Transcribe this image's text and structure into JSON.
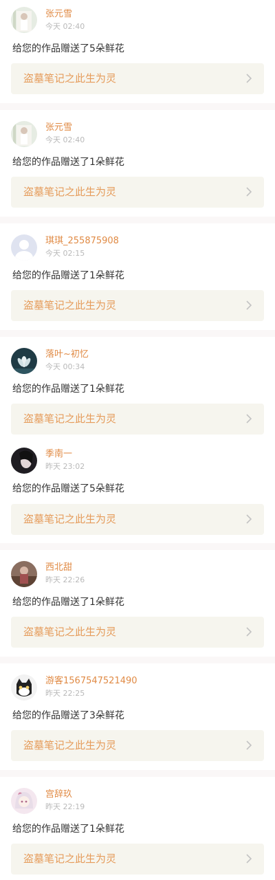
{
  "notifications": [
    {
      "user": "张元雪",
      "time": "今天 02:40",
      "message": "给您的作品赠送了5朵鲜花",
      "work": "盗墓笔记之此生为灵",
      "avatar": "avatar-photo-girl-icon"
    },
    {
      "user": "张元雪",
      "time": "今天 02:40",
      "message": "给您的作品赠送了1朵鲜花",
      "work": "盗墓笔记之此生为灵",
      "avatar": "avatar-photo-girl-icon"
    },
    {
      "user": "琪琪_255875908",
      "time": "今天 02:15",
      "message": "给您的作品赠送了1朵鲜花",
      "work": "盗墓笔记之此生为灵",
      "avatar": "default-avatar-icon"
    },
    {
      "user": "落叶~初忆",
      "time": "今天 00:34",
      "message": "给您的作品赠送了1朵鲜花",
      "work": "盗墓笔记之此生为灵",
      "avatar": "lotus-avatar-icon"
    },
    {
      "user": "季南一",
      "time": "昨天 23:02",
      "message": "给您的作品赠送了5朵鲜花",
      "work": "盗墓笔记之此生为灵",
      "avatar": "dark-portrait-avatar-icon"
    },
    {
      "user": "西北甜",
      "time": "昨天 22:26",
      "message": "给您的作品赠送了1朵鲜花",
      "work": "盗墓笔记之此生为灵",
      "avatar": "photo-avatar-icon"
    },
    {
      "user": "游客1567547521490",
      "time": "昨天 22:25",
      "message": "给您的作品赠送了3朵鲜花",
      "work": "盗墓笔记之此生为灵",
      "avatar": "cat-avatar-icon"
    },
    {
      "user": "宫辞玖",
      "time": "昨天 22:19",
      "message": "给您的作品赠送了1朵鲜花",
      "work": "盗墓笔记之此生为灵",
      "avatar": "anime-avatar-icon"
    }
  ],
  "colors": {
    "username": "#e08a44",
    "time": "#b9b9b9",
    "message": "#333333",
    "card_bg": "#f6f5ee",
    "card_title": "#e59b5a",
    "separator": "#faf7f7"
  }
}
